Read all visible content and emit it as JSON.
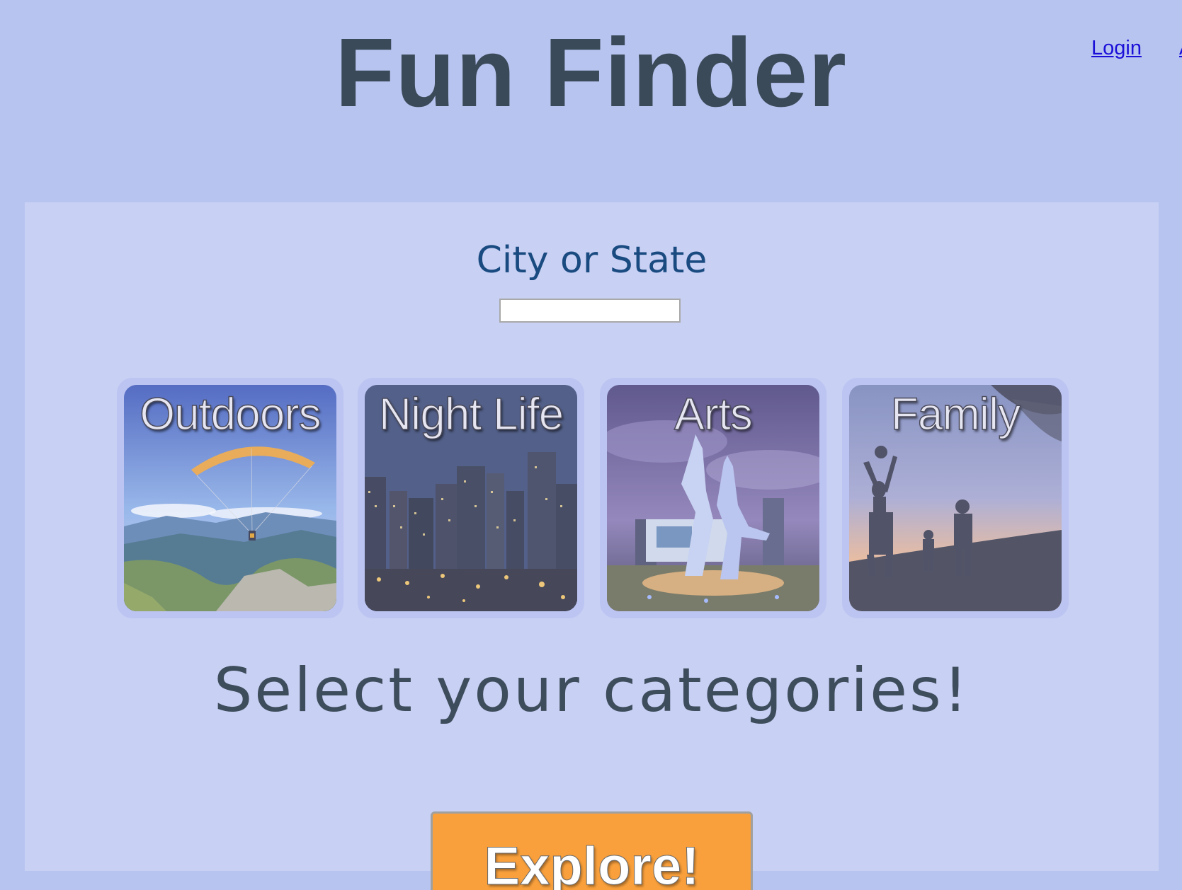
{
  "header": {
    "title": "Fun Finder",
    "links": [
      "Login",
      "A"
    ]
  },
  "search": {
    "label": "City or State",
    "value": "",
    "placeholder": ""
  },
  "categories": [
    {
      "label": "Outdoors"
    },
    {
      "label": "Night Life"
    },
    {
      "label": "Arts"
    },
    {
      "label": "Family"
    }
  ],
  "prompt": "Select your categories!",
  "explore_button": "Explore!",
  "colors": {
    "background": "#b8c4f0",
    "panel": "#c8d0f4",
    "title": "#3a4a59",
    "label": "#1a4b80",
    "button": "#f9a03c",
    "link": "#1a10d8"
  }
}
